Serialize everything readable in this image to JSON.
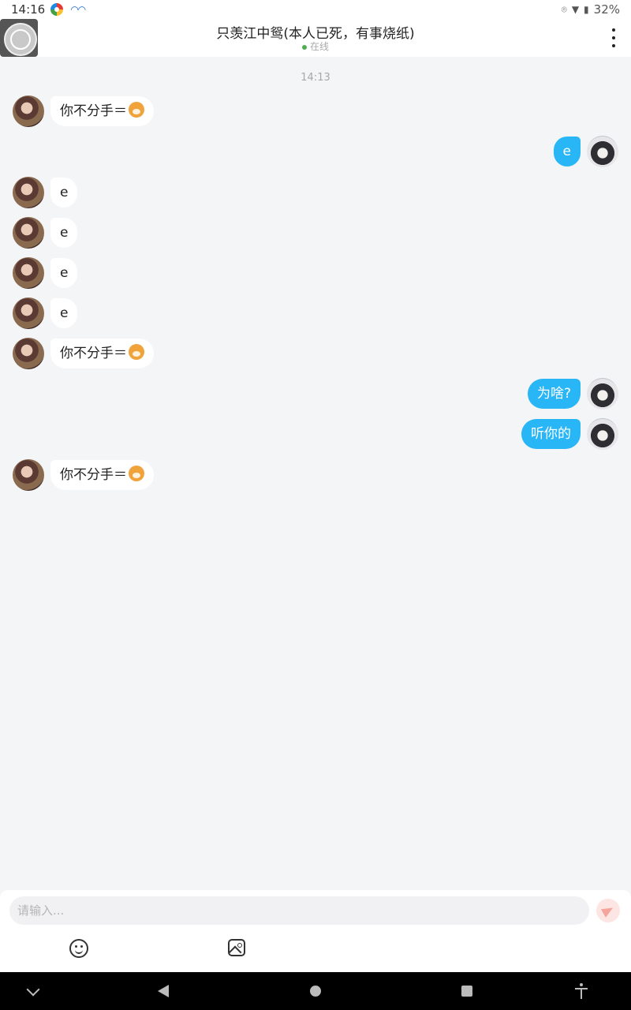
{
  "status_bar": {
    "time": "14:16",
    "battery": "32%"
  },
  "header": {
    "title": "只羡江中鸳(本人已死，有事烧纸)",
    "status": "在线"
  },
  "timestamp": "14:13",
  "messages": [
    {
      "side": "left",
      "text": "你不分手＝",
      "emoji": "dog-face-emoji"
    },
    {
      "side": "right",
      "text": "e"
    },
    {
      "side": "left",
      "text": "e"
    },
    {
      "side": "left",
      "text": "e"
    },
    {
      "side": "left",
      "text": "e"
    },
    {
      "side": "left",
      "text": "e"
    },
    {
      "side": "left",
      "text": "你不分手＝",
      "emoji": "dog-face-emoji"
    },
    {
      "side": "right",
      "text": "为啥?"
    },
    {
      "side": "right",
      "text": "听你的"
    },
    {
      "side": "left",
      "text": "你不分手＝",
      "emoji": "dog-face-emoji"
    }
  ],
  "input": {
    "placeholder": "请输入..."
  },
  "colors": {
    "accent": "#29b6f6",
    "background": "#f4f5f7",
    "online": "#4caf50",
    "send": "#f6a49b"
  }
}
